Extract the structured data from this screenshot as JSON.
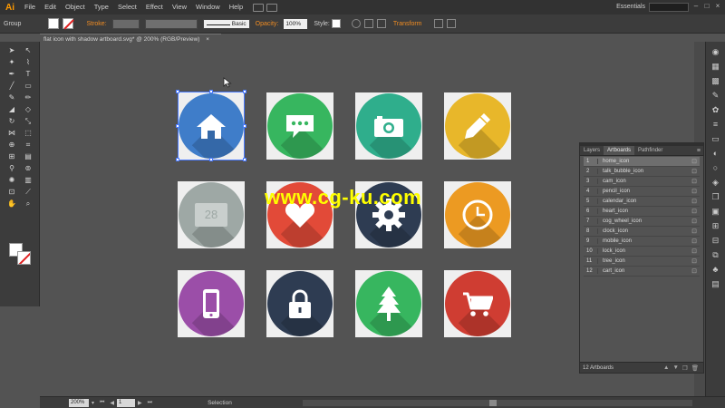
{
  "app": {
    "logo": "Ai",
    "menus": [
      "File",
      "Edit",
      "Object",
      "Type",
      "Select",
      "Effect",
      "View",
      "Window",
      "Help"
    ],
    "workspace": "Essentials"
  },
  "control": {
    "selection_type": "Group",
    "stroke_label": "Stroke:",
    "stroke_profile": "Basic",
    "opacity_label": "Opacity:",
    "opacity_value": "100%",
    "style_label": "Style:",
    "transform_label": "Transform"
  },
  "document": {
    "tab_title": "flat icon with shadow artboard.svg* @ 200% (RGB/Preview)",
    "close_glyph": "×"
  },
  "artboards": [
    {
      "name": "home_icon",
      "color": "#3f7dc9",
      "icon": "home-icon"
    },
    {
      "name": "talk_bubble_icon",
      "color": "#37b65f",
      "icon": "talk-bubble-icon"
    },
    {
      "name": "cam_icon",
      "color": "#2fae8c",
      "icon": "camera-icon"
    },
    {
      "name": "pencil_icon",
      "color": "#e8b72a",
      "icon": "pencil-icon"
    },
    {
      "name": "calendar_icon",
      "color": "#9ea8a5",
      "icon": "calendar-icon",
      "text": "28"
    },
    {
      "name": "heart_icon",
      "color": "#e24a38",
      "icon": "heart-icon"
    },
    {
      "name": "cog_wheel_icon",
      "color": "#2e3c52",
      "icon": "cog-wheel-icon"
    },
    {
      "name": "clock_icon",
      "color": "#ec9a22",
      "icon": "clock-icon"
    },
    {
      "name": "mobile_icon",
      "color": "#9b4ea8",
      "icon": "mobile-icon"
    },
    {
      "name": "lock_icon",
      "color": "#2e3c52",
      "icon": "lock-icon"
    },
    {
      "name": "tree_icon",
      "color": "#37b65f",
      "icon": "tree-icon"
    },
    {
      "name": "cart_icon",
      "color": "#cf3d32",
      "icon": "cart-icon"
    }
  ],
  "panel": {
    "tabs": [
      "Layers",
      "Artboards",
      "Pathfinder"
    ],
    "active_tab": "Artboards",
    "rows": [
      {
        "num": "1",
        "name": "home_icon"
      },
      {
        "num": "2",
        "name": "talk_bubble_icon"
      },
      {
        "num": "3",
        "name": "cam_icon"
      },
      {
        "num": "4",
        "name": "pencil_icon"
      },
      {
        "num": "5",
        "name": "calendar_icon"
      },
      {
        "num": "6",
        "name": "heart_icon"
      },
      {
        "num": "7",
        "name": "cog_wheel_icon"
      },
      {
        "num": "8",
        "name": "clock_icon"
      },
      {
        "num": "9",
        "name": "mobile_icon"
      },
      {
        "num": "10",
        "name": "lock_icon"
      },
      {
        "num": "11",
        "name": "tree_icon"
      },
      {
        "num": "12",
        "name": "cart_icon"
      }
    ],
    "footer_count": "12 Artboards"
  },
  "status": {
    "zoom": "200%",
    "page": "1",
    "tool": "Selection"
  },
  "watermark": "www.cg-ku.com"
}
